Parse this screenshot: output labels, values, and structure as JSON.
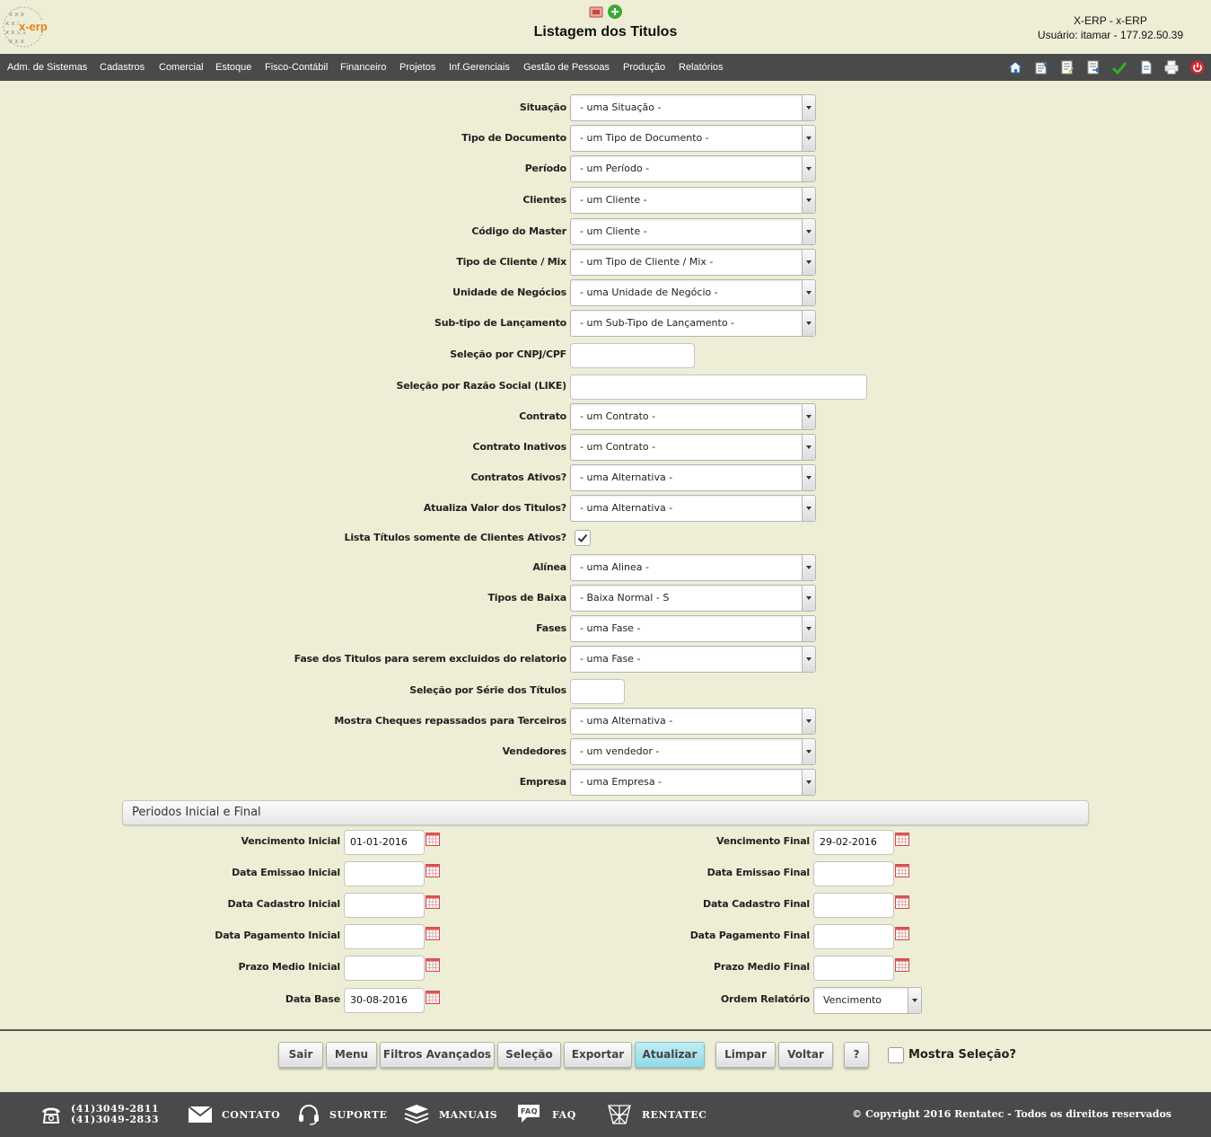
{
  "header": {
    "title": "Listagem dos Titulos",
    "logo_text": "x-erp",
    "system_name": "X-ERP - x-ERP",
    "user_info": "Usuário: itamar - 177.92.50.39"
  },
  "menu": [
    "Adm. de Sistemas",
    "Cadastros",
    "Comercial",
    "Estoque",
    "Fisco-Contábil",
    "Financeiro",
    "Projetos",
    "Inf.Gerenciais",
    "Gestão de Pessoas",
    "Produção",
    "Relatórios"
  ],
  "toolbar_icons": [
    "home-icon",
    "tools-icon",
    "edit-doc-icon",
    "export-doc-icon",
    "check-icon",
    "new-doc-icon",
    "print-icon",
    "power-icon"
  ],
  "form": {
    "situacao": {
      "label": "Situação",
      "value": "- uma Situação -"
    },
    "tipo_documento": {
      "label": "Tipo de Documento",
      "value": "- um Tipo de Documento -"
    },
    "periodo": {
      "label": "Período",
      "value": "- um Período -"
    },
    "clientes": {
      "label": "Clientes",
      "value": "- um Cliente -"
    },
    "codigo_master": {
      "label": "Código do Master",
      "value": "- um Cliente -"
    },
    "tipo_cliente": {
      "label": "Tipo de Cliente / Mix",
      "value": "- um Tipo de Cliente / Mix -"
    },
    "unidade_negocios": {
      "label": "Unidade de Negócios",
      "value": "- uma Unidade de Negócio -"
    },
    "subtipo_lancamento": {
      "label": "Sub-tipo de Lançamento",
      "value": "- um Sub-Tipo de Lançamento -"
    },
    "cnpj": {
      "label": "Seleção por CNPJ/CPF",
      "value": ""
    },
    "razao_social": {
      "label": "Seleção por Razão Social (LIKE)",
      "value": ""
    },
    "contrato": {
      "label": "Contrato",
      "value": "- um Contrato -"
    },
    "contrato_inativos": {
      "label": "Contrato Inativos",
      "value": "- um Contrato -"
    },
    "contratos_ativos": {
      "label": "Contratos Ativos?",
      "value": "- uma Alternativa -"
    },
    "atualiza_valor": {
      "label": "Atualiza Valor dos Titulos?",
      "value": "- uma Alternativa -"
    },
    "lista_ativos": {
      "label": "Lista Títulos somente de Clientes Ativos?",
      "checked": true
    },
    "alinea": {
      "label": "Alínea",
      "value": "- uma Alinea -"
    },
    "tipos_baixa": {
      "label": "Tipos de Baixa",
      "value": "- Baixa Normal - S"
    },
    "fases": {
      "label": "Fases",
      "value": "- uma Fase -"
    },
    "fase_excluidos": {
      "label": "Fase dos Titulos para serem excluidos do relatorio",
      "value": "- uma Fase -"
    },
    "serie": {
      "label": "Seleção por Série dos Títulos",
      "value": ""
    },
    "cheques": {
      "label": "Mostra Cheques repassados para Terceiros",
      "value": "- uma Alternativa -"
    },
    "vendedores": {
      "label": "Vendedores",
      "value": "- um vendedor -"
    },
    "empresa": {
      "label": "Empresa",
      "value": "- uma Empresa -"
    }
  },
  "periodos": {
    "title": "Periodos Inicial e Final",
    "venc_inicial": {
      "label": "Vencimento Inicial",
      "value": "01-01-2016"
    },
    "venc_final": {
      "label": "Vencimento Final",
      "value": "29-02-2016"
    },
    "emissao_inicial": {
      "label": "Data Emissao Inicial",
      "value": ""
    },
    "emissao_final": {
      "label": "Data Emissao Final",
      "value": ""
    },
    "cadastro_inicial": {
      "label": "Data Cadastro Inicial",
      "value": ""
    },
    "cadastro_final": {
      "label": "Data Cadastro Final",
      "value": ""
    },
    "pagamento_inicial": {
      "label": "Data Pagamento Inicial",
      "value": ""
    },
    "pagamento_final": {
      "label": "Data Pagamento Final",
      "value": ""
    },
    "prazo_inicial": {
      "label": "Prazo Medio Inicial",
      "value": ""
    },
    "prazo_final": {
      "label": "Prazo Medio Final",
      "value": ""
    },
    "data_base": {
      "label": "Data Base",
      "value": "30-08-2016"
    },
    "ordem": {
      "label": "Ordem Relatório",
      "value": "Vencimento"
    }
  },
  "buttons": {
    "sair": "Sair",
    "menu": "Menu",
    "filtros": "Filtros Avançados",
    "selecao": "Seleção",
    "exportar": "Exportar",
    "atualizar": "Atualizar",
    "limpar": "Limpar",
    "voltar": "Voltar",
    "help": "?",
    "mostra_selecao": "Mostra Seleção?"
  },
  "footer": {
    "phone1": "(41)3049-2811",
    "phone2": "(41)3049-2833",
    "contato": "CONTATO",
    "suporte": "SUPORTE",
    "manuais": "MANUAIS",
    "faq": "FAQ",
    "rentatec": "RENTATEC",
    "copyright": "© Copyright 2016 Rentatec - Todos os direitos reservados"
  },
  "colors": {
    "background": "#eeeed6",
    "menubar": "#4a4a4a",
    "primary_button": "#a8e2ee"
  }
}
